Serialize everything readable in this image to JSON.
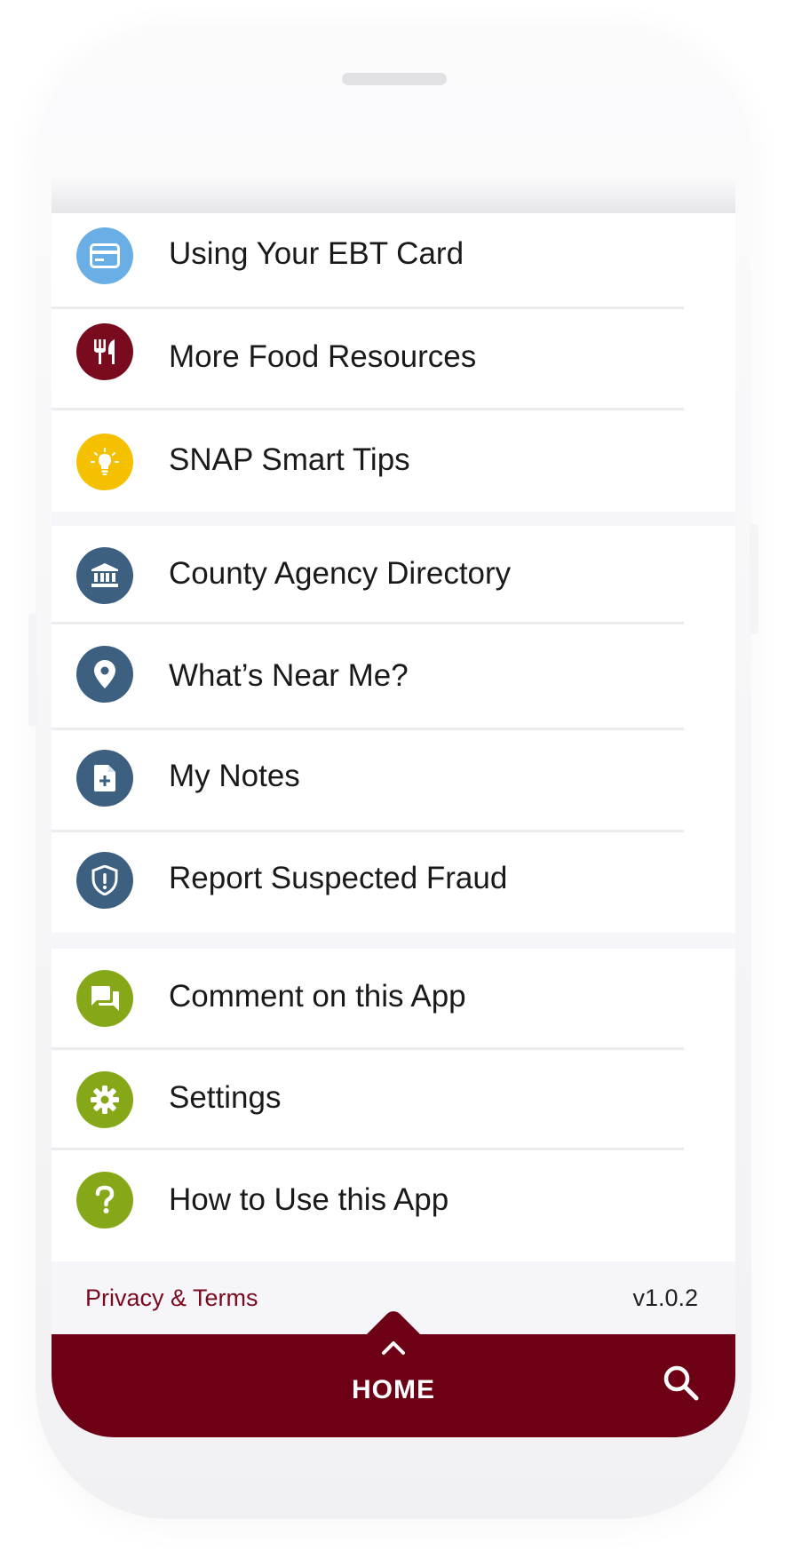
{
  "colors": {
    "accent": "#6e0016",
    "ebt_blue": "#6aaee6",
    "food_red": "#7a0a1e",
    "tips_yellow": "#f5c000",
    "agency_navy": "#3d5f80",
    "support_green": "#86a818"
  },
  "menu": {
    "group1": [
      {
        "label": "Using Your EBT Card",
        "icon": "credit-card-icon"
      },
      {
        "label": "More Food Resources",
        "icon": "utensils-icon"
      },
      {
        "label": "SNAP Smart Tips",
        "icon": "lightbulb-icon"
      }
    ],
    "group2": [
      {
        "label": "County Agency Directory",
        "icon": "bank-building-icon"
      },
      {
        "label": "What’s Near Me?",
        "icon": "map-pin-icon"
      },
      {
        "label": "My Notes",
        "icon": "note-add-icon"
      },
      {
        "label": "Report Suspected Fraud",
        "icon": "shield-alert-icon"
      }
    ],
    "group3": [
      {
        "label": "Comment on this App",
        "icon": "chat-bubbles-icon"
      },
      {
        "label": "Settings",
        "icon": "gear-icon"
      },
      {
        "label": "How to Use this App",
        "icon": "question-icon"
      }
    ]
  },
  "footer": {
    "privacy_label": "Privacy & Terms",
    "version": "v1.0.2"
  },
  "nav": {
    "home_label": "HOME",
    "search_icon": "search-icon",
    "home_icon": "chevron-up-icon"
  }
}
